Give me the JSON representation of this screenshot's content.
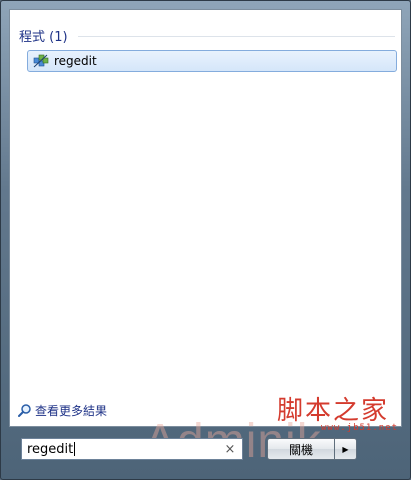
{
  "results": {
    "group_title": "程式 (1)",
    "items": [
      {
        "label": "regedit",
        "icon": "registry-editor-icon"
      }
    ]
  },
  "see_more": {
    "label": "查看更多結果",
    "icon": "search-magnifier-icon"
  },
  "search": {
    "value": "regedit",
    "clear_glyph": "×"
  },
  "shutdown": {
    "label": "關機",
    "arrow_glyph": "▶"
  },
  "watermarks": {
    "cn": "脚本之家",
    "url": "www.jb51.net",
    "admin": "Adminik"
  }
}
